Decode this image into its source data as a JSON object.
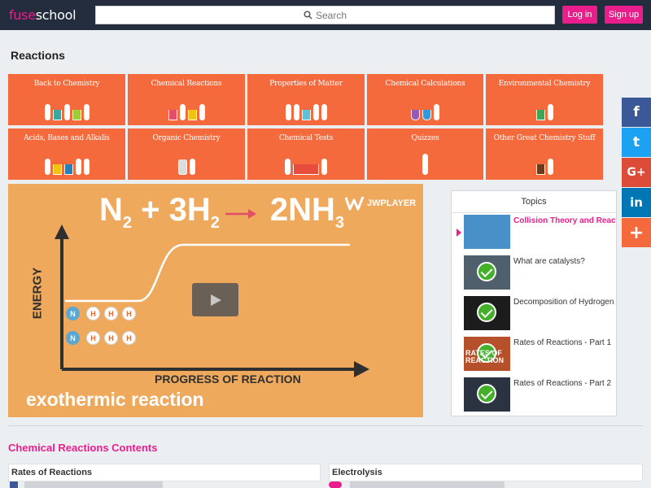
{
  "header": {
    "logo_part1": "fuse",
    "logo_part2": "school",
    "search_placeholder": "Search",
    "login_label": "Log in",
    "signup_label": "Sign up"
  },
  "page_title": "Reactions",
  "categories": [
    {
      "label": "Back to Chemistry"
    },
    {
      "label": "Chemical Reactions"
    },
    {
      "label": "Properties of Matter"
    },
    {
      "label": "Chemical Calculations"
    },
    {
      "label": "Environmental Chemistry"
    },
    {
      "label": "Acids, Bases and Alkalis"
    },
    {
      "label": "Organic Chemistry"
    },
    {
      "label": "Chemical Tests"
    },
    {
      "label": "Quizzes"
    },
    {
      "label": "Other Great Chemistry Stuff"
    }
  ],
  "video": {
    "formula_left": "N",
    "formula_sub1": "2",
    "formula_mid": " + 3H",
    "formula_sub2": "2",
    "formula_right": "2NH",
    "formula_sub3": "3",
    "jw_label": "JWPLAYER",
    "energy_label": "ENERGY",
    "progress_label": "PROGRESS OF REACTION",
    "caption": "exothermic reaction",
    "atom_n": "N",
    "atom_h": "H"
  },
  "topics": {
    "header": "Topics",
    "items": [
      {
        "title": "Collision Theory and Reaction",
        "active": true,
        "completed": false
      },
      {
        "title": "What are catalysts?",
        "active": false,
        "completed": true
      },
      {
        "title": "Decomposition of Hydrogen",
        "active": false,
        "completed": true
      },
      {
        "title": "Rates of Reactions - Part 1",
        "active": false,
        "completed": true,
        "thumb_text": "RATES OF REACTION"
      },
      {
        "title": "Rates of Reactions - Part 2",
        "active": false,
        "completed": true
      }
    ]
  },
  "social": [
    {
      "icon": "facebook-icon",
      "glyph": "f",
      "color": "#3b5998"
    },
    {
      "icon": "twitter-icon",
      "glyph": "t",
      "color": "#1da1f2"
    },
    {
      "icon": "google-plus-icon",
      "glyph": "G+",
      "color": "#dd4b39"
    },
    {
      "icon": "linkedin-icon",
      "glyph": "in",
      "color": "#0077b5"
    },
    {
      "icon": "more-icon",
      "glyph": "+",
      "color": "#f46a3d"
    }
  ],
  "contents": {
    "title": "Chemical Reactions Contents",
    "columns": [
      {
        "heading": "Rates of Reactions"
      },
      {
        "heading": "Electrolysis"
      }
    ]
  },
  "colors": {
    "accent": "#e91e8c",
    "tile": "#f46a3d",
    "topbar": "#232d3d",
    "video_bg": "#eea95d"
  }
}
